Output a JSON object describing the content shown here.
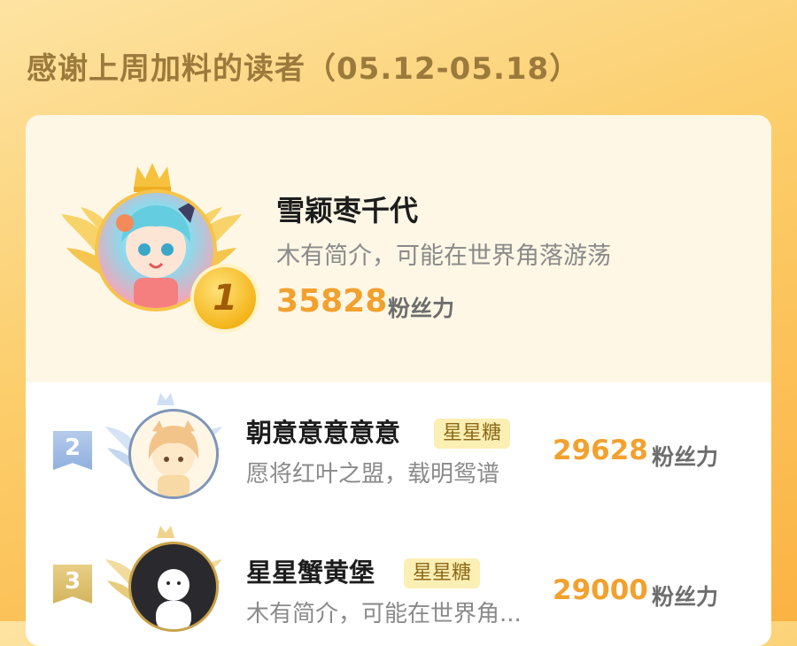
{
  "header": {
    "title": "感谢上周加料的读者（05.12-05.18）"
  },
  "colors": {
    "accent": "#f2a12e",
    "badge_bg": "#fbefb4",
    "background": "#fccd6a"
  },
  "leaderboard": {
    "first": {
      "rank": "1",
      "name": "雪颖枣千代",
      "bio": "木有简介，可能在世界角落游荡",
      "score": "35828",
      "unit": "粉丝力",
      "icons": [
        "crown-icon",
        "wings-icon",
        "gold-medal-icon"
      ]
    },
    "rows": [
      {
        "rank": "2",
        "name": "朝意意意意意",
        "badge": "星星糖",
        "bio": "愿将红叶之盟，载明鸳谱",
        "score": "29628",
        "unit": "粉丝力"
      },
      {
        "rank": "3",
        "name": "星星蟹黄堡",
        "badge": "星星糖",
        "bio": "木有简介，可能在世界角...",
        "score": "29000",
        "unit": "粉丝力"
      }
    ]
  }
}
